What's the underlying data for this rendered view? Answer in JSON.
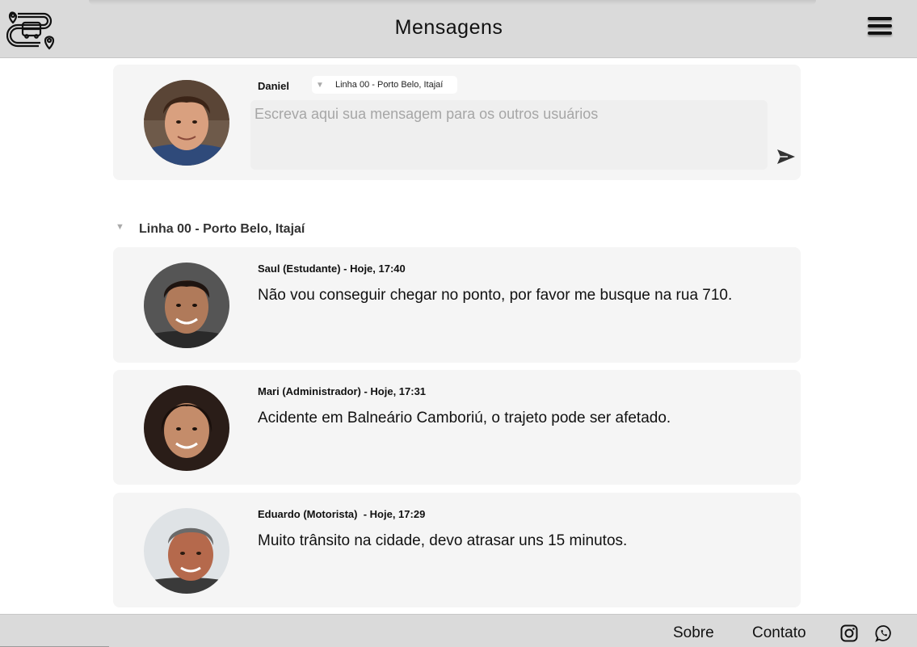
{
  "header": {
    "title": "Mensagens",
    "logo": "bus-route-logo",
    "menu_icon": "hamburger-menu-icon"
  },
  "composer": {
    "author": "Daniel",
    "line_selected": "Linha 00 - Porto Belo, Itajaí",
    "placeholder": "Escreva aqui sua mensagem para os outros usuários",
    "value": "",
    "send_icon": "send-icon"
  },
  "group": {
    "label": "Linha 00 - Porto Belo, Itajaí"
  },
  "messages": [
    {
      "meta": "Saul (Estudante) - Hoje, 17:40",
      "text": "Não vou conseguir chegar no ponto, por favor me busque na rua 710."
    },
    {
      "meta": "Mari (Administrador) - Hoje, 17:31",
      "text": "Acidente em Balneário Camboriú, o trajeto pode ser afetado."
    },
    {
      "meta": "Eduardo (Motorista)  - Hoje, 17:29",
      "text": "Muito trânsito na cidade, devo atrasar uns 15 minutos."
    }
  ],
  "footer": {
    "about": "Sobre",
    "contact": "Contato",
    "instagram_icon": "instagram-icon",
    "whatsapp_icon": "whatsapp-icon"
  },
  "colors": {
    "header_bg": "#dadada",
    "card_bg": "#f5f5f5",
    "page_bg": "#ffffff"
  }
}
